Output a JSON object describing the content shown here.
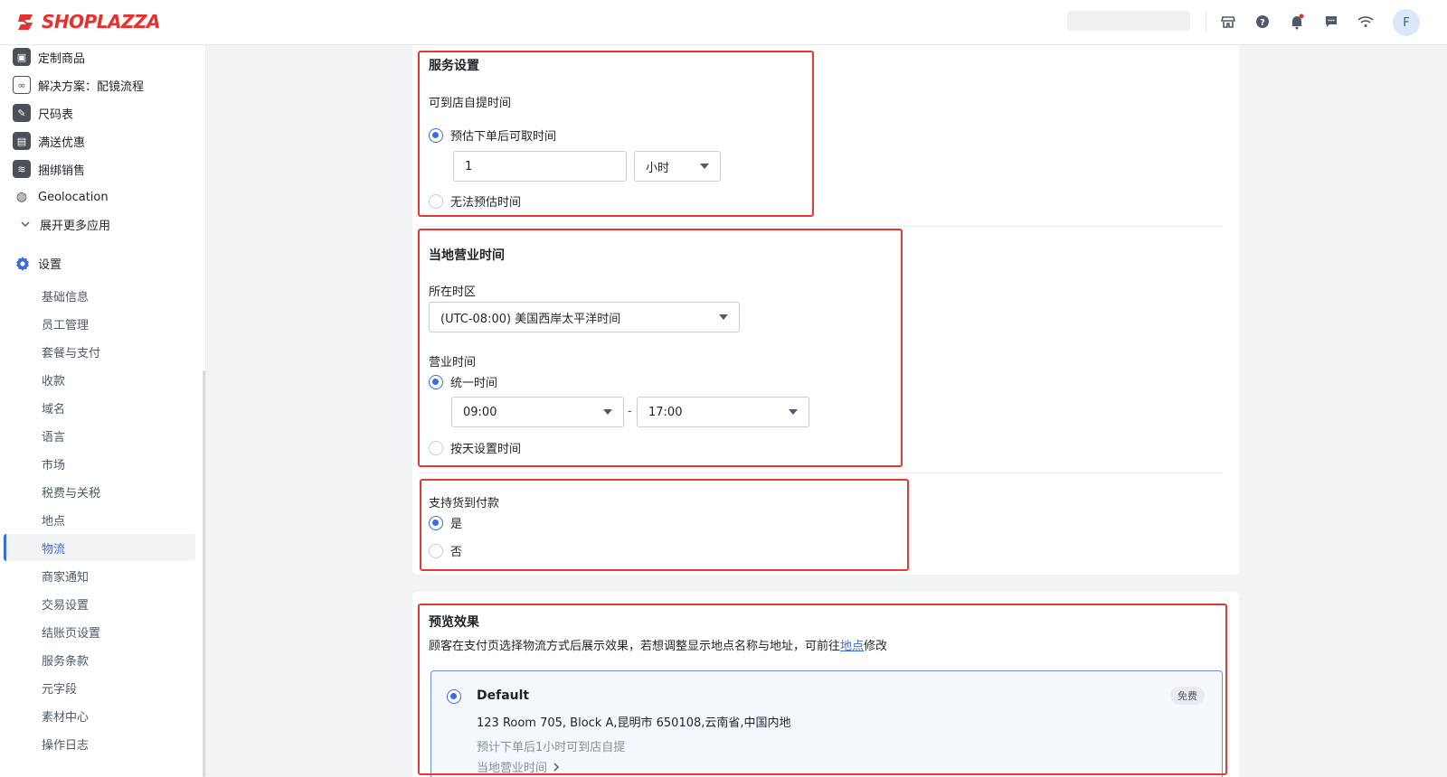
{
  "brand": {
    "logo_text": "SHOPLAZZA",
    "accent": "#e8312f"
  },
  "topbar": {
    "icons": [
      "store-icon",
      "help-icon",
      "bell-icon",
      "message-icon",
      "wifi-icon"
    ],
    "avatar_letter": "F"
  },
  "sidebar": {
    "apps": [
      {
        "label": "定制商品",
        "icon": "custom-product-icon"
      },
      {
        "label": "解决方案：配镜流程",
        "icon": "glasses-icon"
      },
      {
        "label": "尺码表",
        "icon": "ruler-icon"
      },
      {
        "label": "满送优惠",
        "icon": "gift-icon"
      },
      {
        "label": "捆绑销售",
        "icon": "bundle-icon"
      },
      {
        "label": "Geolocation",
        "icon": "globe-icon"
      }
    ],
    "expand_label": "展开更多应用",
    "settings_label": "设置",
    "settings_items": [
      "基础信息",
      "员工管理",
      "套餐与支付",
      "收款",
      "域名",
      "语言",
      "市场",
      "税费与关税",
      "地点",
      "物流",
      "商家通知",
      "交易设置",
      "结账页设置",
      "服务条款",
      "元字段",
      "素材中心",
      "操作日志"
    ],
    "active_item": "物流"
  },
  "service": {
    "title": "服务设置",
    "pickup_label": "可到店自提时间",
    "option_estimate": "预估下单后可取时间",
    "estimate_value": "1",
    "estimate_unit": "小时",
    "option_no_estimate": "无法预估时间"
  },
  "hours": {
    "title": "当地营业时间",
    "timezone_label": "所在时区",
    "timezone_value": "(UTC-08:00) 美国西岸太平洋时间",
    "business_hours_label": "营业时间",
    "option_uniform": "统一时间",
    "start_time": "09:00",
    "separator": "-",
    "end_time": "17:00",
    "option_by_day": "按天设置时间"
  },
  "cod": {
    "label": "支持货到付款",
    "option_yes": "是",
    "option_no": "否"
  },
  "preview": {
    "title": "预览效果",
    "desc_prefix": "顾客在支付页选择物流方式后展示效果，若想调整显示地点名称与地址，可前往",
    "desc_link": "地点",
    "desc_suffix": "修改",
    "option_name": "Default",
    "badge": "免费",
    "address": "123 Room 705, Block A,昆明市 650108,云南省,中国内地",
    "pickup_note": "预计下单后1小时可到店自提",
    "hours_link": "当地营业时间"
  },
  "colors": {
    "primary": "#3a6ce0",
    "highlight": "#e53935"
  }
}
